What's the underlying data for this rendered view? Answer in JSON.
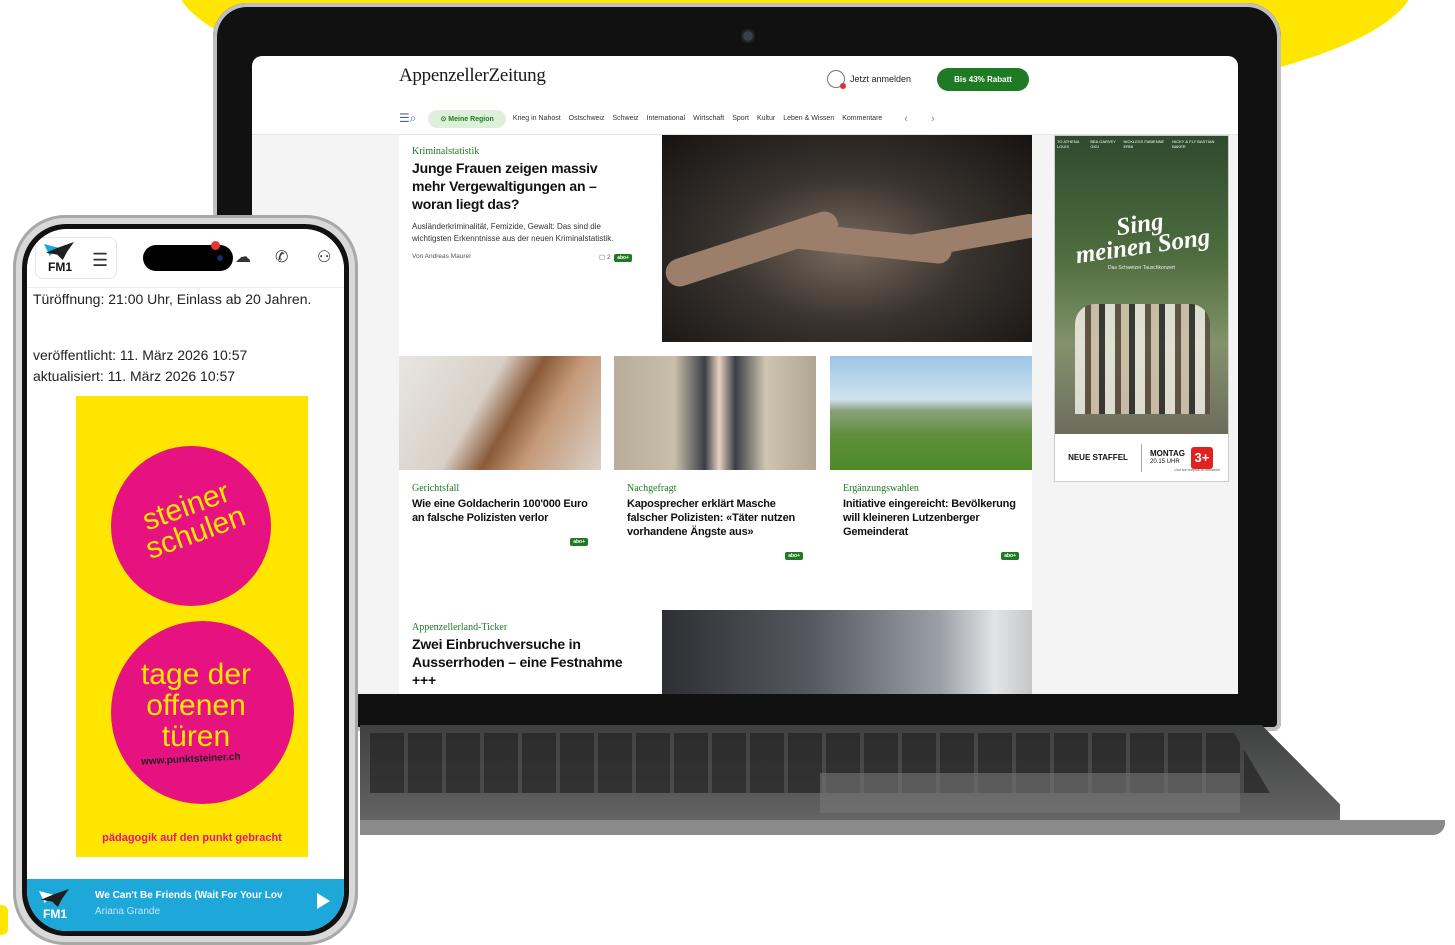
{
  "newspaper": {
    "logo": "AppenzellerZeitung",
    "login": "Jetzt anmelden",
    "promo": "Bis 43% Rabatt",
    "nav": {
      "region": "Meine Region",
      "items": [
        "Krieg in Nahost",
        "Ostschweiz",
        "Schweiz",
        "International",
        "Wirtschaft",
        "Sport",
        "Kultur",
        "Leben & Wissen",
        "Kommentare"
      ],
      "arrows": "‹ ›"
    },
    "main_article": {
      "kicker": "Kriminalstatistik",
      "headline": "Junge Frauen zeigen massiv mehr Vergewaltigungen an – woran liegt das?",
      "lead": "Ausländerkriminalität, Femizide, Gewalt: Das sind die wichtigsten Erkenntnisse aus der neuen Kriminalstatistik.",
      "author": "Von Andreas Maurer",
      "comments": "2",
      "badge": "abo+"
    },
    "cards": [
      {
        "kicker": "Gerichtsfall",
        "headline": "Wie eine Goldacherin 100'000 Euro an falsche Polizisten verlor",
        "badge": "abo+"
      },
      {
        "kicker": "Nachgefragt",
        "headline": "Kaposprecher erklärt Masche falscher Polizisten: «Täter nutzen vorhandene Ängste aus»",
        "badge": "abo+"
      },
      {
        "kicker": "Ergänzungswahlen",
        "headline": "Initiative eingereicht: Bevölkerung will kleineren Lutzenberger Gemeinderat",
        "badge": "abo+"
      }
    ],
    "bottom_article": {
      "kicker": "Appenzellerland-Ticker",
      "headline": "Zwei Einbruchversuche in Ausserrhoden – eine Festnahme +++"
    },
    "ad": {
      "top_names": [
        "TO ATHENA LOUIS",
        "BEA GARVEY GIGI",
        "NICKLESS FABIENNE ERNI",
        "NICKY & FLY BASTIAN BAKER"
      ],
      "title_line1": "Sing",
      "title_line2": "meinen Song",
      "subtitle": "Das Schweizer Tauschkonzert",
      "staffel": "NEUE STAFFEL",
      "day": "MONTAG",
      "time": "20.15 UHR",
      "channel": "3+",
      "stream": "Und auf oneplus.ch streamen"
    }
  },
  "phone": {
    "line_event": "Türöffnung: 21:00 Uhr, Einlass ab 20 Jahren.",
    "published": "veröffentlicht: 11. März 2026 10:57",
    "updated": "aktualisiert: 11. März 2026 10:57",
    "ad": {
      "circle1": "steiner schulen",
      "circle2": "tage der offenen türen",
      "url": "www.punktsteiner.ch",
      "claim": "pädagogik auf den punkt gebracht"
    },
    "logo_text": "FM1",
    "player": {
      "title": "We Can't Be Friends (Wait For Your Lov",
      "artist": "Ariana Grande"
    }
  },
  "colors": {
    "accent_green": "#1f7a24",
    "brand_yellow": "#ffe600",
    "ad_magenta": "#e6127f",
    "fm1_blue": "#1ea7d9"
  }
}
